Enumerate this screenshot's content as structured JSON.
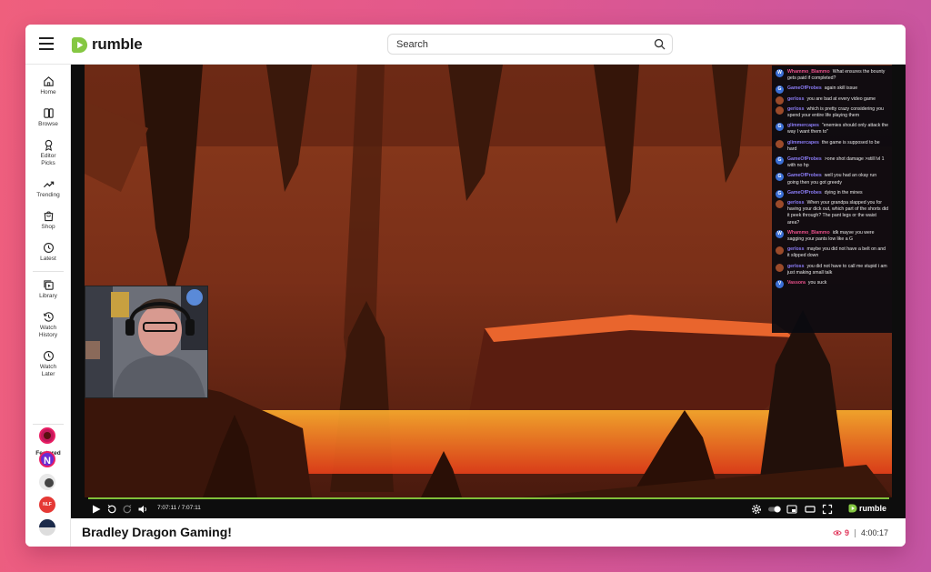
{
  "header": {
    "logo_text": "rumble",
    "search_placeholder": "Search"
  },
  "sidebar": {
    "items": [
      {
        "label": "Home",
        "icon": "home-icon"
      },
      {
        "label": "Browse",
        "icon": "browse-icon"
      },
      {
        "label": "Editor Picks",
        "icon": "award-icon"
      },
      {
        "label": "Trending",
        "icon": "trending-icon"
      },
      {
        "label": "Shop",
        "icon": "shop-icon"
      },
      {
        "label": "Latest",
        "icon": "clock-icon"
      },
      {
        "label": "Library",
        "icon": "library-icon"
      },
      {
        "label": "Watch History",
        "icon": "history-icon"
      },
      {
        "label": "Watch Later",
        "icon": "clock-icon"
      }
    ],
    "featured_label": "Featured"
  },
  "player": {
    "time": "7:07:11 / 7:07:11",
    "brand": "rumble",
    "progress": 1.0
  },
  "chat": [
    {
      "user": "Whammo_Blammo",
      "text": "What ensures the bounty gets paid if completed?",
      "color": "#e8508a",
      "avatar": "W",
      "avatar_bg": "#3b6fd6"
    },
    {
      "user": "GameOfProbes",
      "text": "again skill issue",
      "color": "#8b7cf6",
      "avatar": "G",
      "avatar_bg": "#3b6fd6"
    },
    {
      "user": "gerloss",
      "text": "you are bad at every video game",
      "color": "#8b7cf6",
      "avatar": "",
      "avatar_bg": "#9b4a2a"
    },
    {
      "user": "gerloss",
      "text": "which is pretty crazy considering you spend your entire life playing them",
      "color": "#8b7cf6",
      "avatar": "",
      "avatar_bg": "#9b4a2a"
    },
    {
      "user": "glimmercapes",
      "text": "\"enemies should only attack the way I want them to\"",
      "color": "#8b7cf6",
      "avatar": "G",
      "avatar_bg": "#3b6fd6"
    },
    {
      "user": "glimmercapes",
      "text": "the game is supposed to be hard",
      "color": "#8b7cf6",
      "avatar": "",
      "avatar_bg": "#9b4a2a"
    },
    {
      "user": "GameOfProbes",
      "text": ">one shot damage >still lvl 1 with no hp",
      "color": "#8b7cf6",
      "avatar": "G",
      "avatar_bg": "#3b6fd6"
    },
    {
      "user": "GameOfProbes",
      "text": "well you had an okay run going then you got greedy",
      "color": "#8b7cf6",
      "avatar": "G",
      "avatar_bg": "#3b6fd6"
    },
    {
      "user": "GameOfProbes",
      "text": "dying in the mines",
      "color": "#8b7cf6",
      "avatar": "G",
      "avatar_bg": "#3b6fd6"
    },
    {
      "user": "gerloss",
      "text": "When your grandpa slapped you for having your dick out, which part of the shorts did it peek through? The pant legs or the waist area?",
      "color": "#8b7cf6",
      "avatar": "",
      "avatar_bg": "#9b4a2a"
    },
    {
      "user": "Whammo_Blammo",
      "text": "idk mayve you were sagging your pants low like a G",
      "color": "#e8508a",
      "avatar": "W",
      "avatar_bg": "#3b6fd6"
    },
    {
      "user": "gerloss",
      "text": "maybe you did not have a belt on and it slipped down",
      "color": "#8b7cf6",
      "avatar": "",
      "avatar_bg": "#9b4a2a"
    },
    {
      "user": "gerloss",
      "text": "you did not have to call me stupid i am just making small talk",
      "color": "#8b7cf6",
      "avatar": "",
      "avatar_bg": "#9b4a2a"
    },
    {
      "user": "Vassora",
      "text": "you suck",
      "color": "#e8508a",
      "avatar": "V",
      "avatar_bg": "#3b6fd6"
    }
  ],
  "video": {
    "title": "Bradley Dragon Gaming!",
    "viewers": "9",
    "duration": "4:00:17"
  }
}
